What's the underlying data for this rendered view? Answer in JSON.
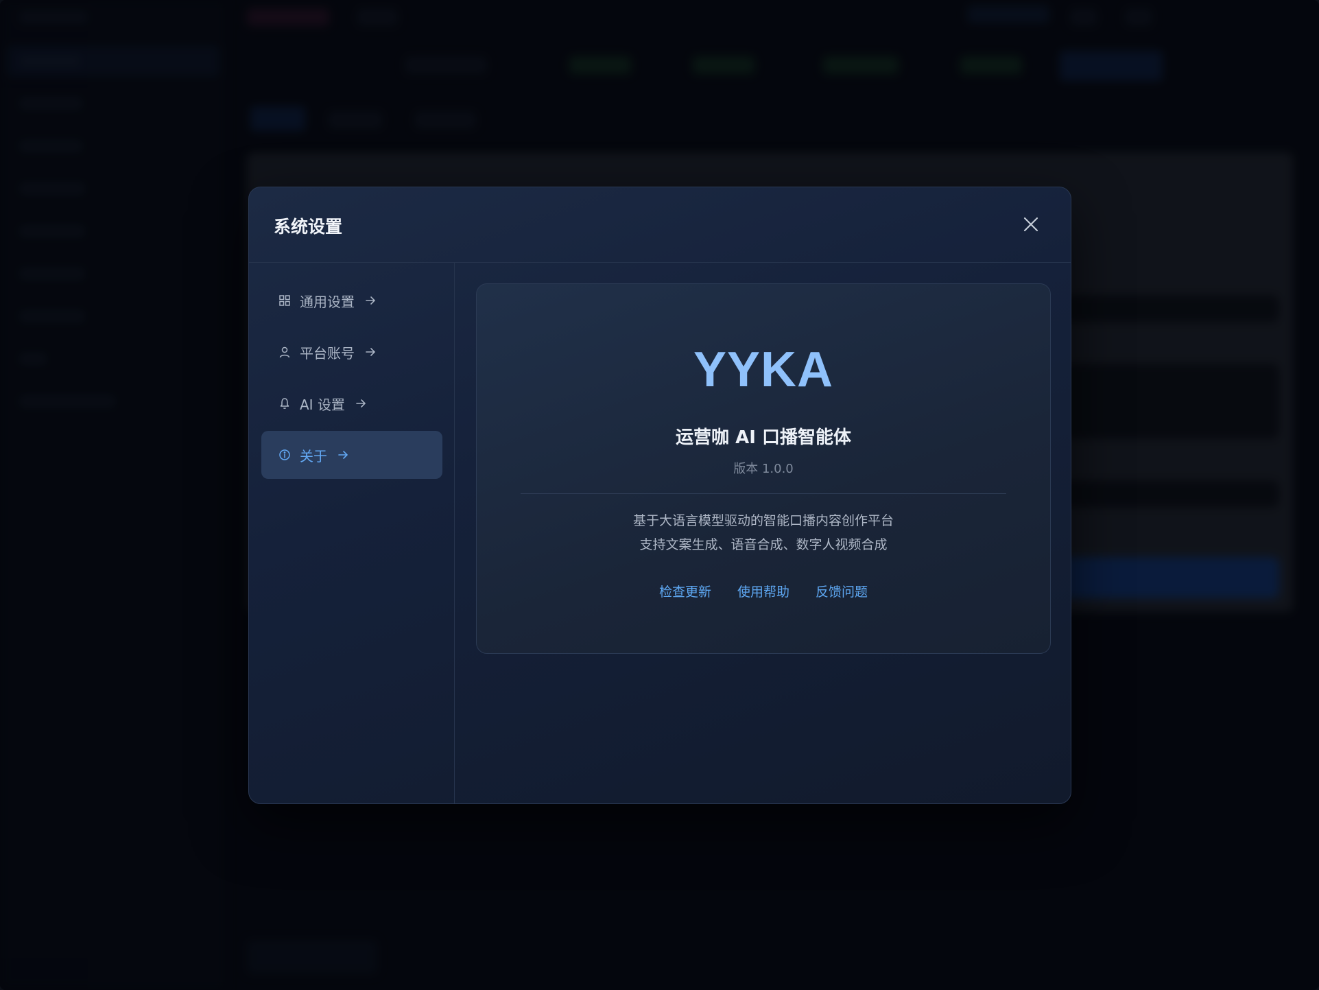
{
  "modal": {
    "title": "系统设置"
  },
  "nav": {
    "items": [
      {
        "label": "通用设置",
        "icon": "grid-icon",
        "active": false
      },
      {
        "label": "平台账号",
        "icon": "user-icon",
        "active": false
      },
      {
        "label": "AI 设置",
        "icon": "bell-icon",
        "active": false
      },
      {
        "label": "关于",
        "icon": "info-icon",
        "active": true
      }
    ]
  },
  "about": {
    "brand": "YYKA",
    "product_name": "运营咖 AI 口播智能体",
    "version": "版本 1.0.0",
    "description_line1": "基于大语言模型驱动的智能口播内容创作平台",
    "description_line2": "支持文案生成、语音合成、数字人视频合成",
    "links": {
      "check_update": "检查更新",
      "help": "使用帮助",
      "feedback": "反馈问题"
    }
  },
  "colors": {
    "accent": "#63a9f5",
    "brand": "#8fc1fb",
    "active_nav_bg": "#2a3d5d"
  }
}
